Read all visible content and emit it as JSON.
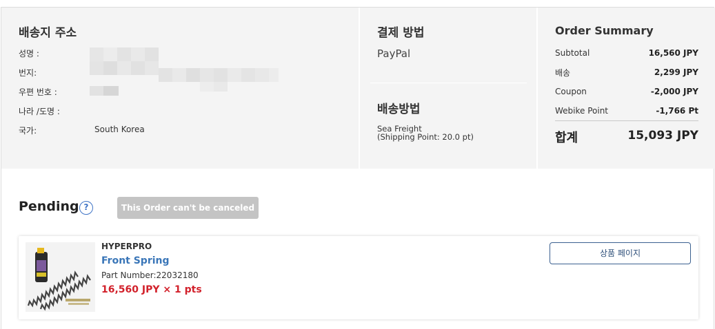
{
  "shipping_address": {
    "title": "배송지 주소",
    "name_label": "성명 :",
    "street_label": "번지:",
    "postal_label": "우편 번호 :",
    "state_label": "나라 /도명 :",
    "country_label": "국가:",
    "country_value": "South Korea"
  },
  "payment": {
    "title": "결제 방법",
    "method": "PayPal"
  },
  "shipping_method": {
    "title": "배송방법",
    "line1": "Sea Freight",
    "line2": "(Shipping Point: 20.0 pt)"
  },
  "summary": {
    "title": "Order Summary",
    "rows": [
      {
        "label": "Subtotal",
        "value": "16,560 JPY"
      },
      {
        "label": "배송",
        "value": "2,299 JPY"
      },
      {
        "label": "Coupon",
        "value": "-2,000 JPY"
      },
      {
        "label": "Webike Point",
        "value": "-1,766 Pt"
      }
    ],
    "total_label": "합계",
    "total_value": "15,093 JPY"
  },
  "order_status": {
    "title": "Pending",
    "help_icon": "?",
    "cancel_button": "This Order can't be canceled"
  },
  "item": {
    "brand": "HYPERPRO",
    "name": "Front Spring",
    "part_number": "Part Number:22032180",
    "price": "16,560 JPY × 1 pts",
    "product_page_button": "상품 페이지",
    "thumb_icon": "fork-spring-product-image"
  },
  "colors": {
    "panel_bg": "#f4f4f4",
    "link_blue": "#3a76b8",
    "price_red": "#d2212b",
    "disabled_gray": "#c4c4c4"
  }
}
